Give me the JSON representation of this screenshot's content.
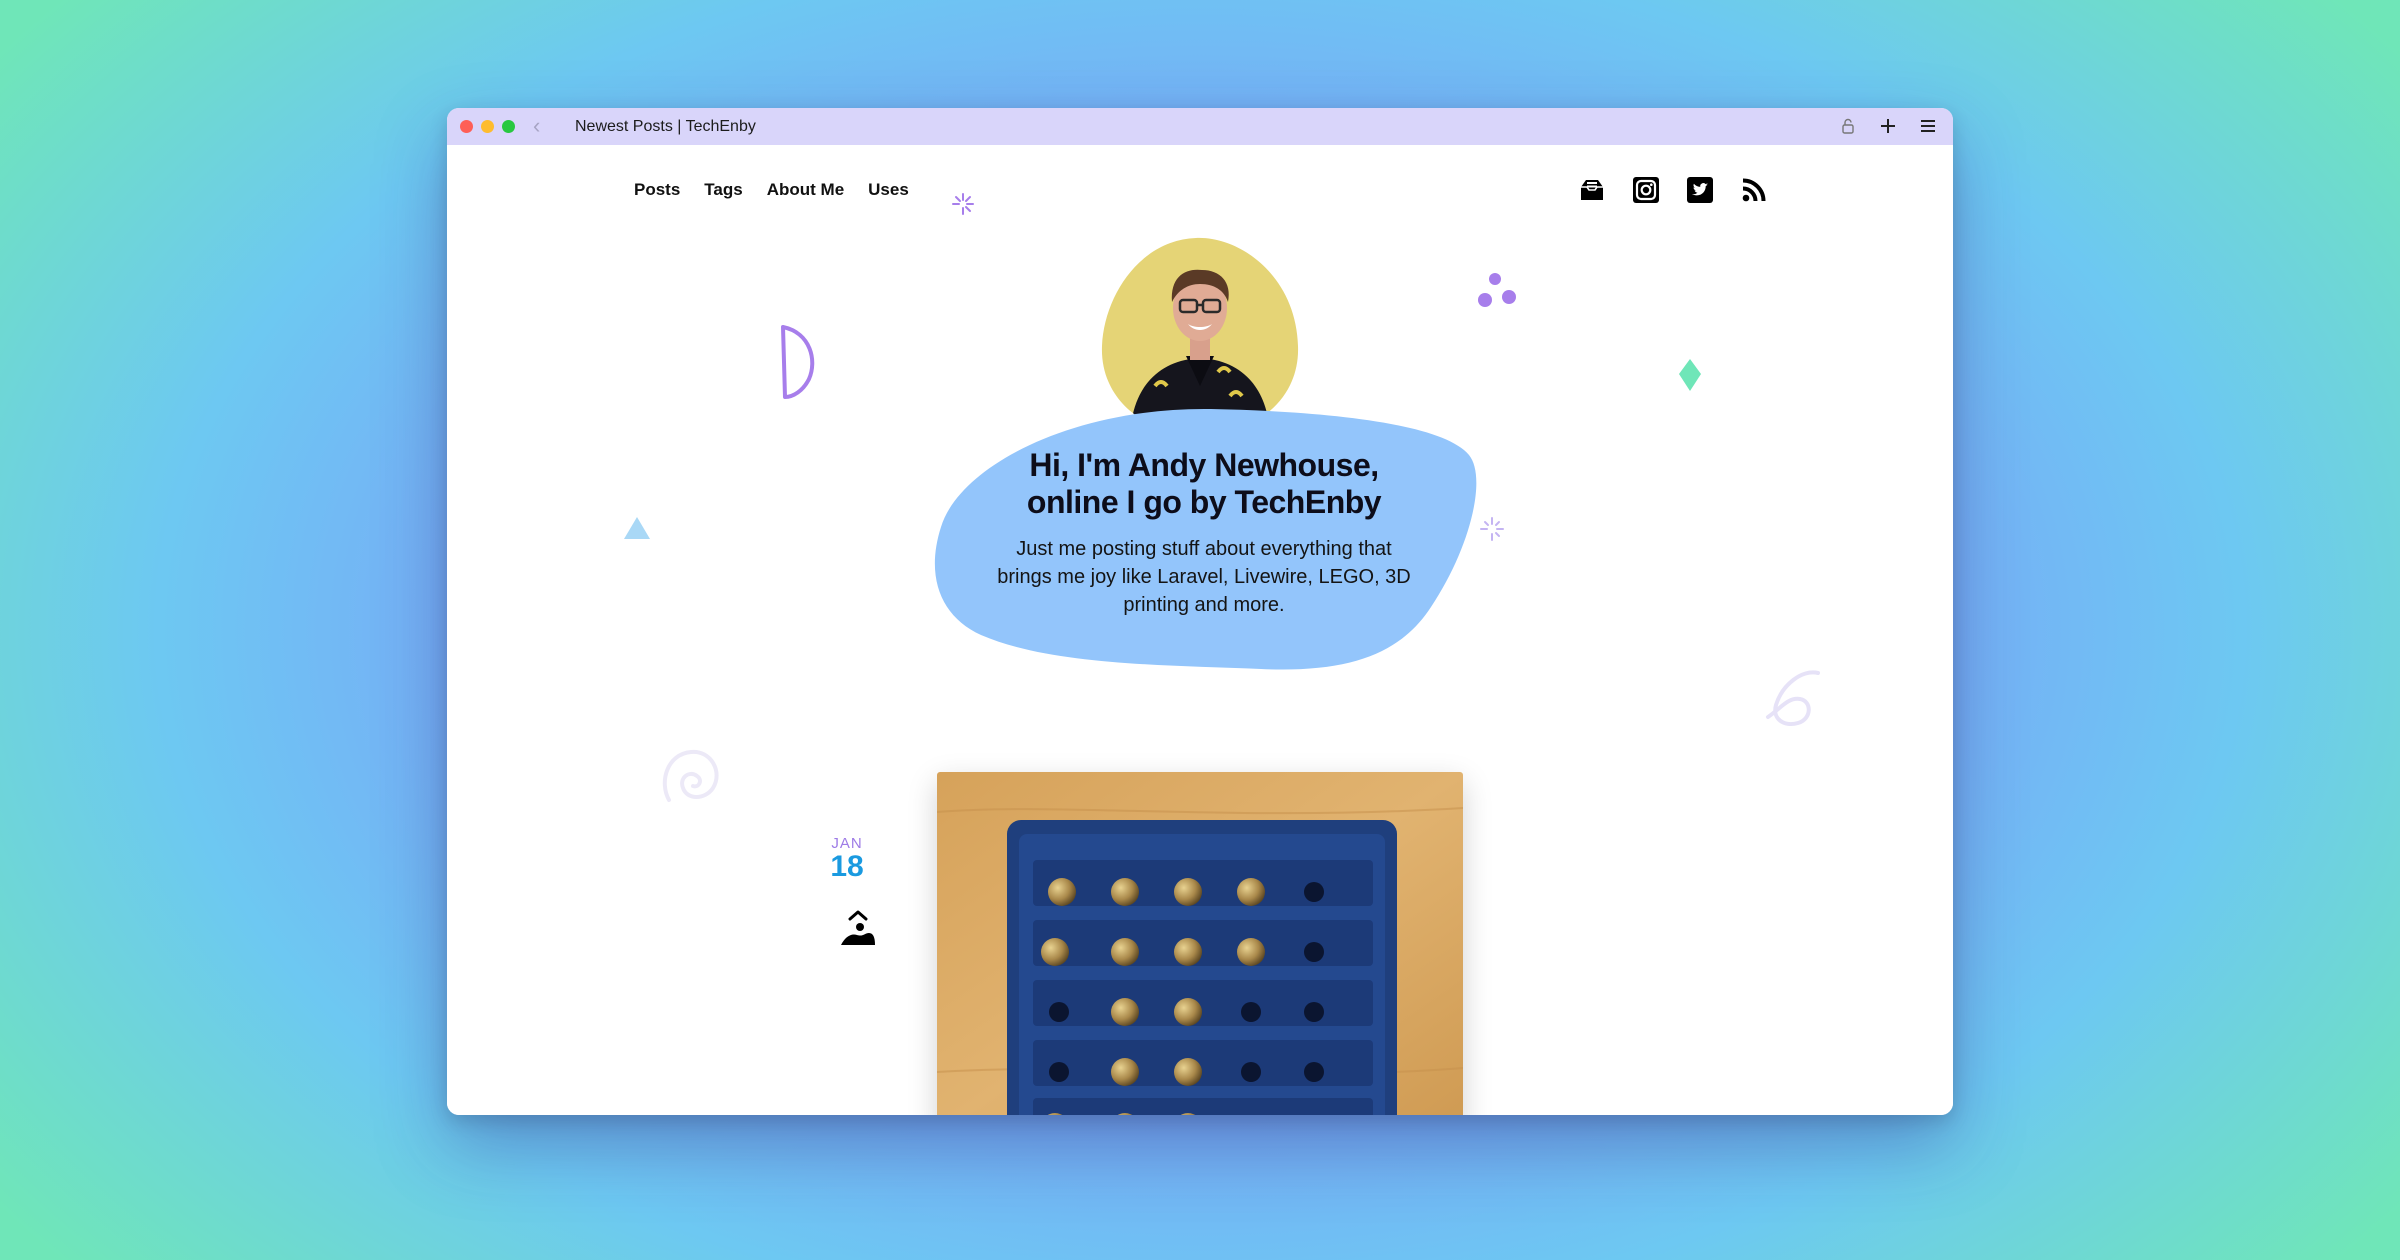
{
  "browser": {
    "tab_title": "Newest Posts | TechEnby"
  },
  "nav": {
    "items": [
      "Posts",
      "Tags",
      "About Me",
      "Uses"
    ]
  },
  "social": [
    {
      "name": "mail-icon"
    },
    {
      "name": "instagram-icon"
    },
    {
      "name": "twitter-icon"
    },
    {
      "name": "rss-icon"
    }
  ],
  "hero": {
    "title_line1": "Hi, I'm Andy Newhouse,",
    "title_line2": "online I go by TechEnby",
    "subtitle": "Just me posting stuff about everything that brings me joy like Laravel, Livewire, LEGO, 3D printing and more."
  },
  "post": {
    "month": "JAN",
    "day": "18",
    "type_icon": "image-post-icon"
  },
  "colors": {
    "titlebar": "#d9d5fa",
    "hero_blob": "#93c5fb",
    "avatar_blob": "#e5d476",
    "accent_purple": "#a77eeb",
    "accent_blue": "#1a9ae0",
    "accent_green": "#6fe6b8"
  }
}
